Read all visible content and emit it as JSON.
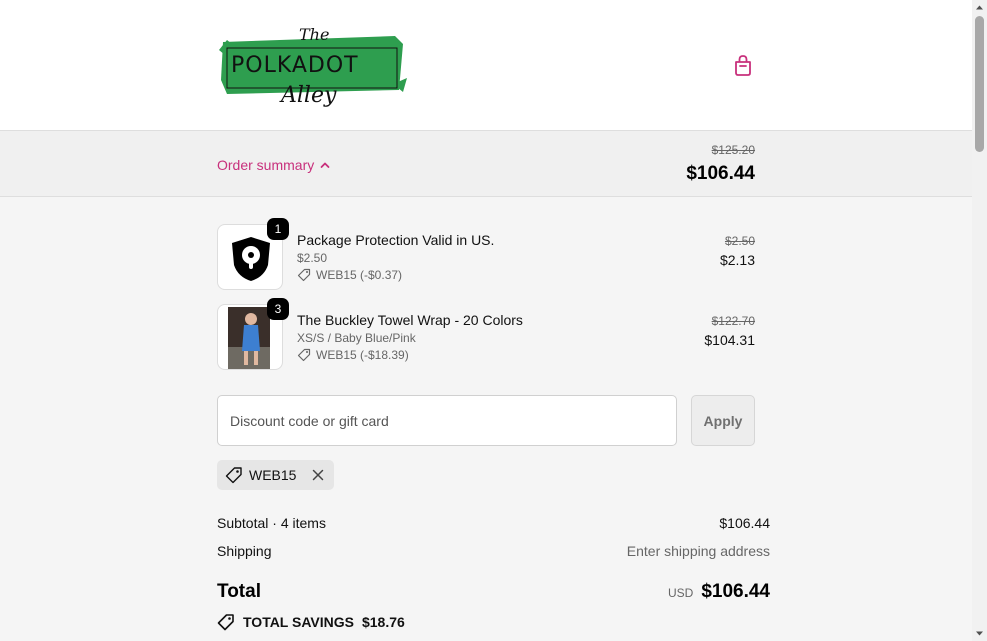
{
  "header": {
    "logo": {
      "line1": "The",
      "line2": "POLKADOT",
      "line3": "Alley"
    },
    "cart_icon": "shopping-bag-icon"
  },
  "summary": {
    "toggle_label": "Order summary",
    "original_total": "$125.20",
    "total": "$106.44"
  },
  "items": [
    {
      "qty": "1",
      "name": "Package Protection Valid in US.",
      "variant": "$2.50",
      "discount": "WEB15 (-$0.37)",
      "original_price": "$2.50",
      "price": "$2.13"
    },
    {
      "qty": "3",
      "name": "The Buckley Towel Wrap - 20 Colors",
      "variant": "XS/S / Baby Blue/Pink",
      "discount": "WEB15 (-$18.39)",
      "original_price": "$122.70",
      "price": "$104.31"
    }
  ],
  "discount": {
    "placeholder": "Discount code or gift card",
    "apply_label": "Apply",
    "applied_code": "WEB15"
  },
  "totals": {
    "subtotal_label": "Subtotal · 4 items",
    "subtotal_value": "$106.44",
    "shipping_label": "Shipping",
    "shipping_value": "Enter shipping address",
    "total_label": "Total",
    "currency": "USD",
    "total_value": "$106.44",
    "savings_label": "TOTAL SAVINGS",
    "savings_value": "$18.76"
  },
  "colors": {
    "accent": "#c8307c",
    "logo_green": "#2e9e4f"
  }
}
